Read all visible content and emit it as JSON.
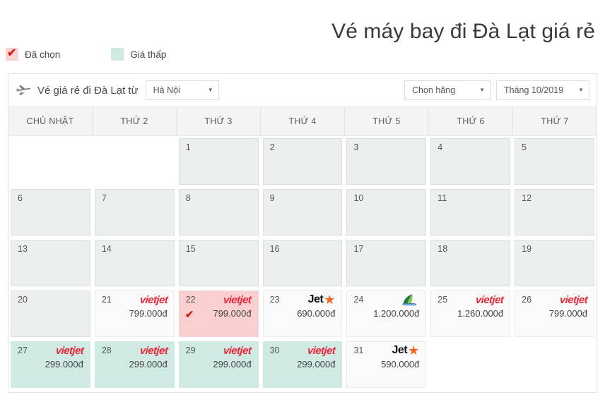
{
  "page": {
    "title": "Vé máy bay đi Đà Lạt giá rẻ"
  },
  "legend": {
    "items": [
      {
        "label": "Đã chọn",
        "swatch": "selected",
        "color": "#f9d2d2",
        "check": "✔"
      },
      {
        "label": "Giá thấp",
        "swatch": "low",
        "color": "#cfe9e3",
        "check": ""
      }
    ]
  },
  "toolbar": {
    "plane_icon": "airplane-icon",
    "title": "Vé giá rẻ đi Đà Lạt từ",
    "origin": {
      "value": "Hà Nội",
      "caret": "▼"
    },
    "airline": {
      "value": "Chọn hãng",
      "caret": "▼"
    },
    "month": {
      "value": "Tháng 10/2019",
      "caret": "▼"
    }
  },
  "calendar": {
    "weekdays": [
      "CHỦ NHẬT",
      "THỨ 2",
      "THỨ 3",
      "THỨ 4",
      "THỨ 5",
      "THỨ 6",
      "THỨ 7"
    ],
    "rows": [
      [
        {
          "day": "",
          "state": "blank",
          "airline": "",
          "price": "",
          "selected": false
        },
        {
          "day": "",
          "state": "blank",
          "airline": "",
          "price": "",
          "selected": false
        },
        {
          "day": "1",
          "state": "past",
          "airline": "",
          "price": "",
          "selected": false
        },
        {
          "day": "2",
          "state": "past",
          "airline": "",
          "price": "",
          "selected": false
        },
        {
          "day": "3",
          "state": "past",
          "airline": "",
          "price": "",
          "selected": false
        },
        {
          "day": "4",
          "state": "past",
          "airline": "",
          "price": "",
          "selected": false
        },
        {
          "day": "5",
          "state": "past",
          "airline": "",
          "price": "",
          "selected": false
        }
      ],
      [
        {
          "day": "6",
          "state": "past",
          "airline": "",
          "price": "",
          "selected": false
        },
        {
          "day": "7",
          "state": "past",
          "airline": "",
          "price": "",
          "selected": false
        },
        {
          "day": "8",
          "state": "past",
          "airline": "",
          "price": "",
          "selected": false
        },
        {
          "day": "9",
          "state": "past",
          "airline": "",
          "price": "",
          "selected": false
        },
        {
          "day": "10",
          "state": "past",
          "airline": "",
          "price": "",
          "selected": false
        },
        {
          "day": "11",
          "state": "past",
          "airline": "",
          "price": "",
          "selected": false
        },
        {
          "day": "12",
          "state": "past",
          "airline": "",
          "price": "",
          "selected": false
        }
      ],
      [
        {
          "day": "13",
          "state": "past",
          "airline": "",
          "price": "",
          "selected": false
        },
        {
          "day": "14",
          "state": "past",
          "airline": "",
          "price": "",
          "selected": false
        },
        {
          "day": "15",
          "state": "past",
          "airline": "",
          "price": "",
          "selected": false
        },
        {
          "day": "16",
          "state": "past",
          "airline": "",
          "price": "",
          "selected": false
        },
        {
          "day": "17",
          "state": "past",
          "airline": "",
          "price": "",
          "selected": false
        },
        {
          "day": "18",
          "state": "past",
          "airline": "",
          "price": "",
          "selected": false
        },
        {
          "day": "19",
          "state": "past",
          "airline": "",
          "price": "",
          "selected": false
        }
      ],
      [
        {
          "day": "20",
          "state": "past",
          "airline": "",
          "price": "",
          "selected": false
        },
        {
          "day": "21",
          "state": "normal",
          "airline": "vietjet",
          "price": "799.000đ",
          "selected": false
        },
        {
          "day": "22",
          "state": "selected",
          "airline": "vietjet",
          "price": "799.000đ",
          "selected": true
        },
        {
          "day": "23",
          "state": "normal",
          "airline": "jetstar",
          "price": "690.000đ",
          "selected": false
        },
        {
          "day": "24",
          "state": "normal",
          "airline": "vietnamairlines",
          "price": "1.200.000đ",
          "selected": false
        },
        {
          "day": "25",
          "state": "normal",
          "airline": "vietjet",
          "price": "1.260.000đ",
          "selected": false
        },
        {
          "day": "26",
          "state": "normal",
          "airline": "vietjet",
          "price": "799.000đ",
          "selected": false
        }
      ],
      [
        {
          "day": "27",
          "state": "low",
          "airline": "vietjet",
          "price": "299.000đ",
          "selected": false
        },
        {
          "day": "28",
          "state": "low",
          "airline": "vietjet",
          "price": "299.000đ",
          "selected": false
        },
        {
          "day": "29",
          "state": "low",
          "airline": "vietjet",
          "price": "299.000đ",
          "selected": false
        },
        {
          "day": "30",
          "state": "low",
          "airline": "vietjet",
          "price": "299.000đ",
          "selected": false
        },
        {
          "day": "31",
          "state": "normal",
          "airline": "jetstar",
          "price": "590.000đ",
          "selected": false
        },
        {
          "day": "",
          "state": "blank",
          "airline": "",
          "price": "",
          "selected": false
        },
        {
          "day": "",
          "state": "blank",
          "airline": "",
          "price": "",
          "selected": false
        }
      ]
    ],
    "check_glyph": "✔",
    "airline_labels": {
      "vietjet": "vietjet",
      "jetstar": "Jet",
      "jetstar_star": "★",
      "vietnamairlines": "vietnam-airlines-lotus"
    }
  }
}
